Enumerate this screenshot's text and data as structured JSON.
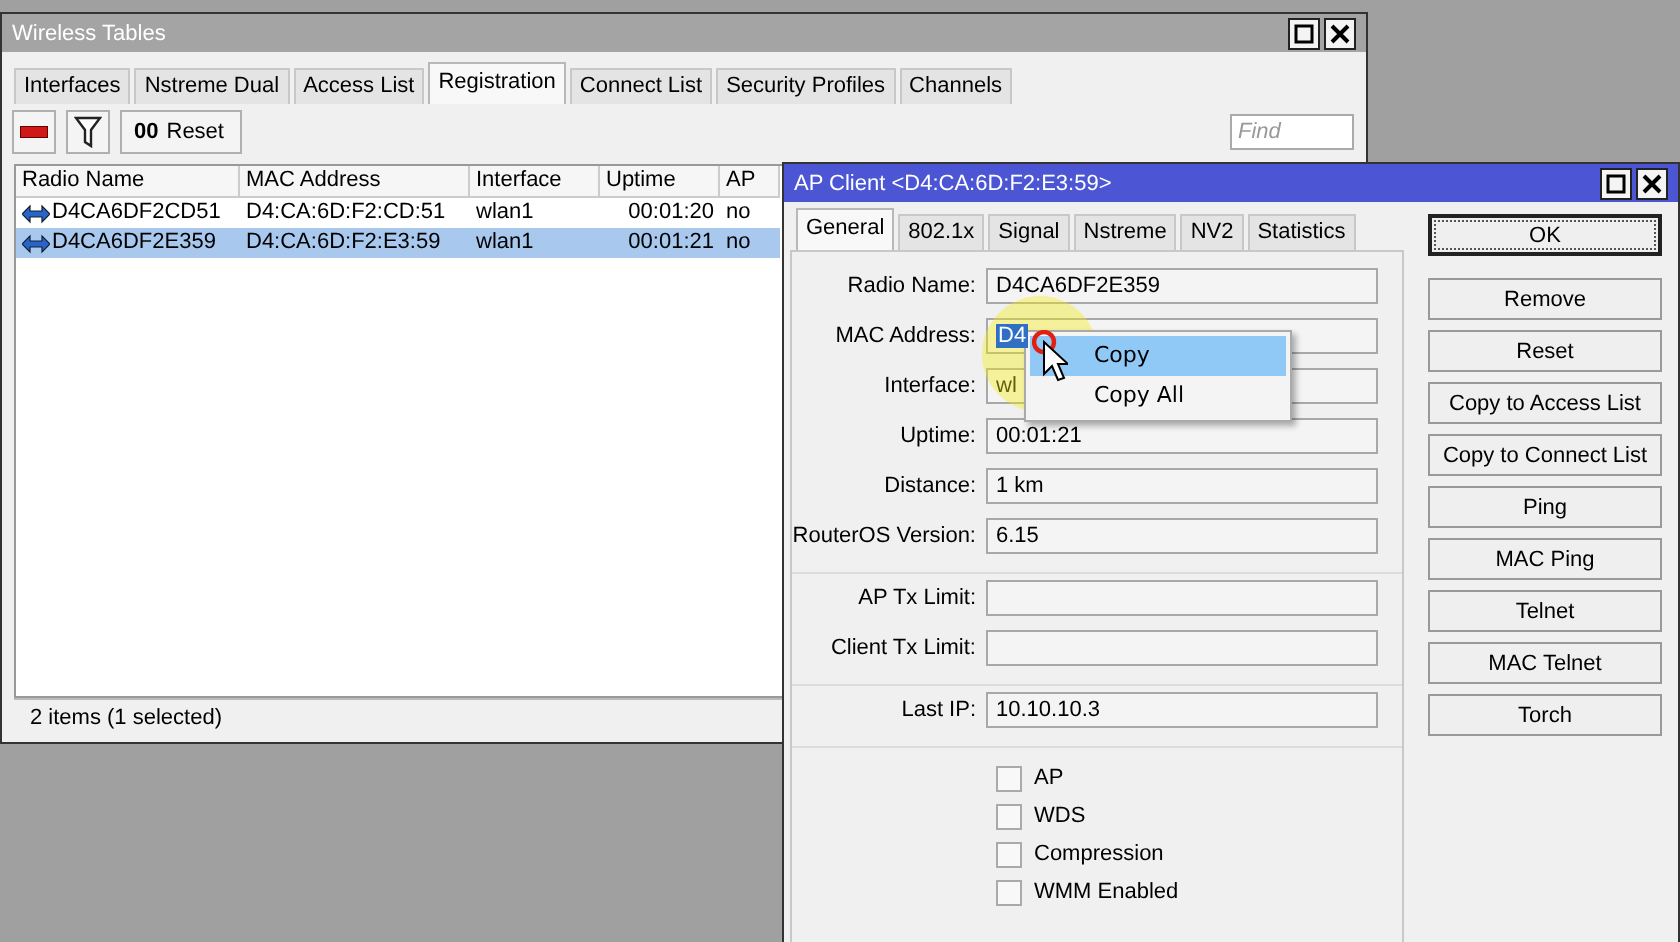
{
  "wireless_window": {
    "title": "Wireless Tables",
    "active": false,
    "tabs": [
      {
        "label": "Interfaces",
        "selected": false
      },
      {
        "label": "Nstreme Dual",
        "selected": false
      },
      {
        "label": "Access List",
        "selected": false
      },
      {
        "label": "Registration",
        "selected": true
      },
      {
        "label": "Connect List",
        "selected": false
      },
      {
        "label": "Security Profiles",
        "selected": false
      },
      {
        "label": "Channels",
        "selected": false
      }
    ],
    "toolbar": {
      "reset_icon": "00",
      "reset_label": "Reset"
    },
    "find": {
      "placeholder": "Find"
    },
    "table": {
      "columns": [
        "Radio Name",
        "MAC Address",
        "Interface",
        "Uptime",
        "AP"
      ],
      "rows": [
        {
          "cells": [
            "D4CA6DF2CD51",
            "D4:CA:6D:F2:CD:51",
            "wlan1",
            "00:01:20",
            "no"
          ],
          "selected": false
        },
        {
          "cells": [
            "D4CA6DF2E359",
            "D4:CA:6D:F2:E3:59",
            "wlan1",
            "00:01:21",
            "no"
          ],
          "selected": true
        }
      ]
    },
    "status_bar": "2 items (1 selected)"
  },
  "client_window": {
    "title": "AP Client <D4:CA:6D:F2:E3:59>",
    "active": true,
    "tabs": [
      {
        "label": "General",
        "selected": true
      },
      {
        "label": "802.1x",
        "selected": false
      },
      {
        "label": "Signal",
        "selected": false
      },
      {
        "label": "Nstreme",
        "selected": false
      },
      {
        "label": "NV2",
        "selected": false
      },
      {
        "label": "Statistics",
        "selected": false
      }
    ],
    "sections": [
      [
        {
          "label": "Radio Name:",
          "value": "D4CA6DF2E359"
        },
        {
          "label": "MAC Address:",
          "value": "D4",
          "text_selected": true
        },
        {
          "label": "Interface:",
          "value": "wl"
        },
        {
          "label": "Uptime:",
          "value": "00:01:21"
        },
        {
          "label": "Distance:",
          "value": "1 km"
        },
        {
          "label": "RouterOS Version:",
          "value": "6.15"
        }
      ],
      [
        {
          "label": "AP Tx Limit:"
        },
        {
          "label": "Client Tx Limit:"
        }
      ],
      [
        {
          "label": "Last IP:",
          "value": "10.10.10.3"
        }
      ]
    ],
    "checkboxes": [
      {
        "label": "AP",
        "checked": false
      },
      {
        "label": "WDS",
        "checked": false
      },
      {
        "label": "Compression",
        "checked": false
      },
      {
        "label": "WMM Enabled",
        "checked": false
      }
    ],
    "buttons": [
      {
        "label": "OK",
        "focused": true
      },
      {
        "label": "Remove",
        "focused": false
      },
      {
        "label": "Reset",
        "focused": false
      },
      {
        "label": "Copy to Access List",
        "focused": false
      },
      {
        "label": "Copy to Connect List",
        "focused": false
      },
      {
        "label": "Ping",
        "focused": false
      },
      {
        "label": "MAC Ping",
        "focused": false
      },
      {
        "label": "Telnet",
        "focused": false
      },
      {
        "label": "MAC Telnet",
        "focused": false
      },
      {
        "label": "Torch",
        "focused": false
      }
    ]
  },
  "context_menu": {
    "items": [
      {
        "label": "Copy",
        "selected": true
      },
      {
        "label": "Copy All",
        "selected": false
      }
    ]
  }
}
